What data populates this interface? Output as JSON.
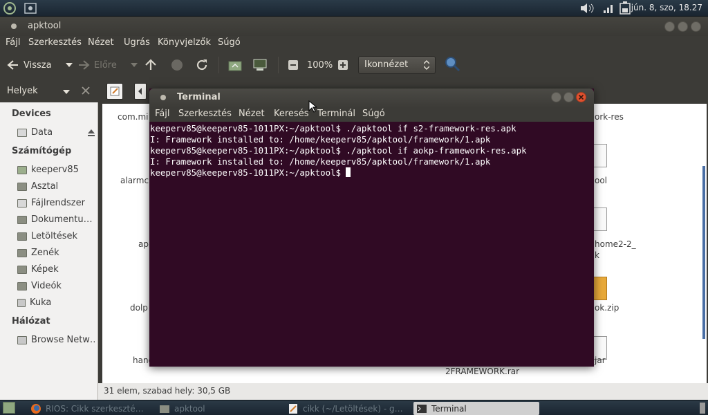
{
  "top_panel": {
    "clock": "jún. 8, szo, 18.27",
    "icons": [
      "app-launcher-icon",
      "system-settings-icon",
      "volume-icon",
      "signal-icon",
      "battery-icon"
    ]
  },
  "nautilus": {
    "title": "apktool",
    "menu": [
      "Fájl",
      "Szerkesztés",
      "Nézet",
      "Ugrás",
      "Könyvjelzők",
      "Súgó"
    ],
    "toolbar": {
      "back": "Vissza",
      "forward": "Előre",
      "zoom": "100%",
      "view_mode": "Ikonnézet"
    },
    "sidebar": {
      "header": "Helyek",
      "sections": [
        {
          "title": "Devices",
          "items": [
            "Data"
          ]
        },
        {
          "title": "Számítógép",
          "items": [
            "keeperv85",
            "Asztal",
            "Fájlrendszer",
            "Dokumentu…",
            "Letöltések",
            "Zenék",
            "Képek",
            "Videók",
            "Kuka"
          ]
        },
        {
          "title": "Hálózat",
          "items": [
            "Browse Netw…"
          ]
        }
      ]
    },
    "files_left": [
      "com.mi",
      "alarmc",
      "apl",
      "dolp",
      "hand"
    ],
    "files_right": [
      "ork-res",
      "ool",
      "home2-2_",
      "k",
      "ok.zip",
      "jar"
    ],
    "file_bottom": "2FRAMEWORK.rar",
    "status": "31 elem, szabad hely: 30,5 GB"
  },
  "terminal": {
    "title": "Terminal",
    "menu": [
      "Fájl",
      "Szerkesztés",
      "Nézet",
      "Keresés",
      "Terminál",
      "Súgó"
    ],
    "lines": [
      "keeperv85@keeperv85-1011PX:~/apktool$ ./apktool if s2-framework-res.apk",
      "I: Framework installed to: /home/keeperv85/apktool/framework/1.apk",
      "keeperv85@keeperv85-1011PX:~/apktool$ ./apktool if aokp-framework-res.apk",
      "I: Framework installed to: /home/keeperv85/apktool/framework/1.apk"
    ],
    "prompt": "keeperv85@keeperv85-1011PX:~/apktool$ "
  },
  "taskbar": {
    "items": [
      "RIOS: Cikk szerkeszté…",
      "apktool",
      "cikk (~/Letöltések) - g…",
      "Terminal"
    ],
    "active_index": 3
  },
  "colors": {
    "terminal_bg": "#300a24",
    "window_chrome": "#3c3b37",
    "close_button": "#e0512f"
  }
}
